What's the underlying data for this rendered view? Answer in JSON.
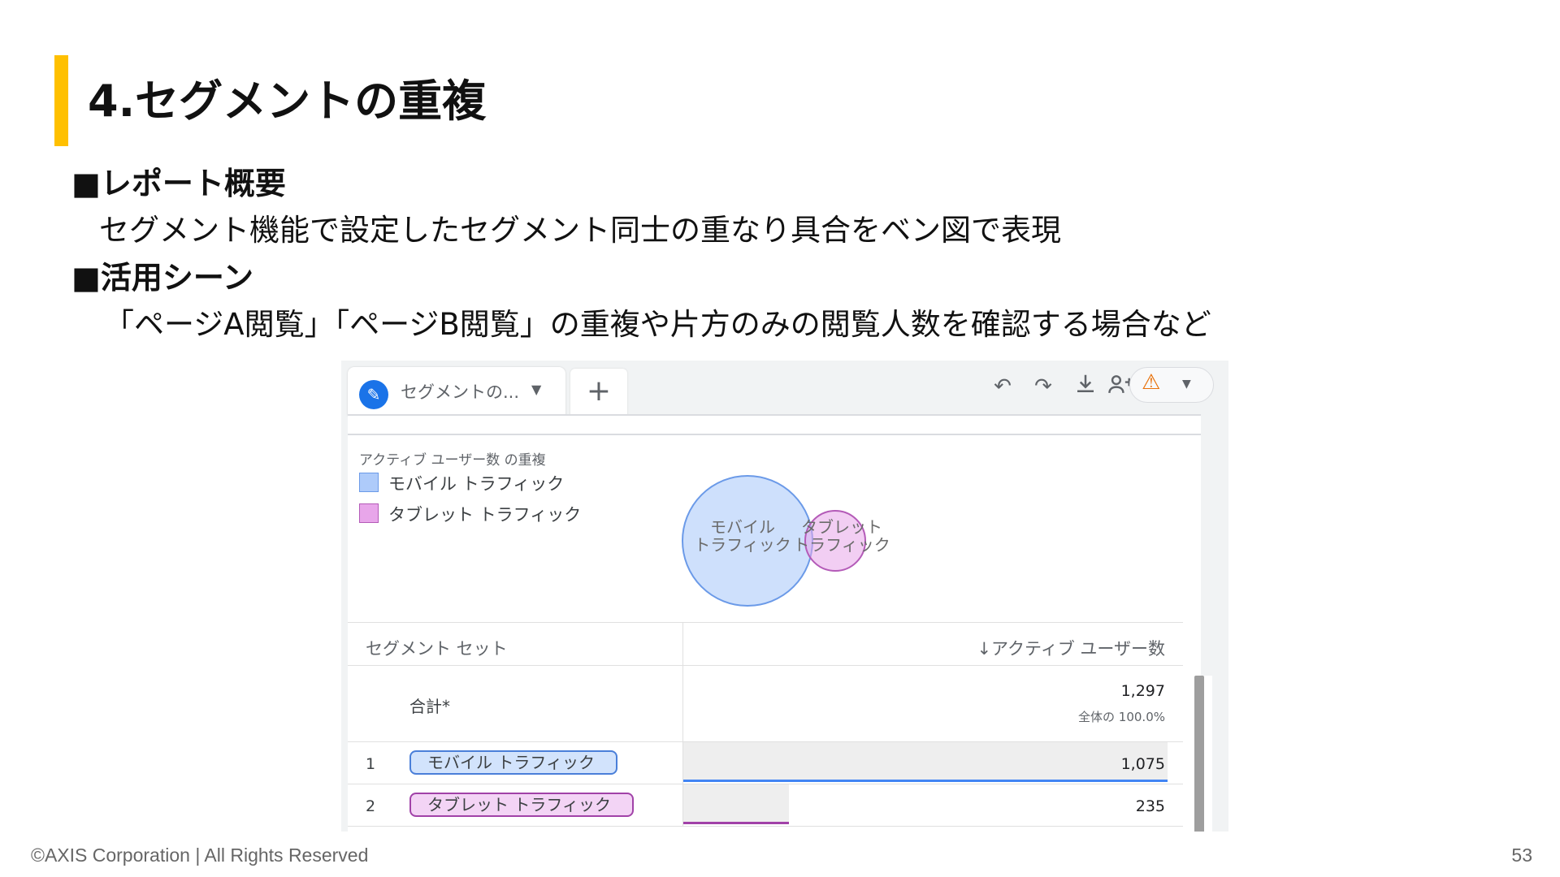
{
  "slide": {
    "title": "4.セグメントの重複",
    "section1_heading": "■レポート概要",
    "section1_body": "セグメント機能で設定したセグメント同士の重なり具合をベン図で表現",
    "section2_heading": "■活用シーン",
    "section2_body": "「ページA閲覧」「ページB閲覧」の重複や片方のみの閲覧人数を確認する場合など",
    "accent_color": "#ffc000"
  },
  "toolbar": {
    "tab_label": "セグメントの...",
    "edit_icon": "pencil-icon",
    "add_tab_label": "+",
    "undo_icon": "undo-icon",
    "redo_icon": "redo-icon",
    "download_icon": "download-icon",
    "share_icon": "share-user-icon",
    "alert_icon": "warning-icon"
  },
  "report": {
    "subtitle": "アクティブ ユーザー数 の重複",
    "legend": [
      {
        "label": "モバイル トラフィック",
        "color": "#aecbfa",
        "border": "#6b9ae8"
      },
      {
        "label": "タブレット トラフィック",
        "color": "#e8a6ea",
        "border": "#b45bb8"
      }
    ],
    "venn": {
      "a_line1": "モバイル",
      "a_line2": "トラフィック",
      "b_line1": "タブレット",
      "b_line2": "トラフィック"
    },
    "table": {
      "col_segment": "セグメント セット",
      "col_users": "↓アクティブ ユーザー数",
      "total": {
        "label": "合計*",
        "value": "1,297",
        "pct": "全体の 100.0%"
      },
      "rows": [
        {
          "num": "1",
          "label": "モバイル トラフィック",
          "value": "1,075",
          "fraction": 1.0,
          "color": "#4285f4"
        },
        {
          "num": "2",
          "label": "タブレット トラフィック",
          "value": "235",
          "fraction": 0.2186,
          "color": "#a142a8"
        }
      ]
    }
  },
  "footer": {
    "copyright": "©AXIS Corporation | All Rights Reserved",
    "page": "53"
  }
}
